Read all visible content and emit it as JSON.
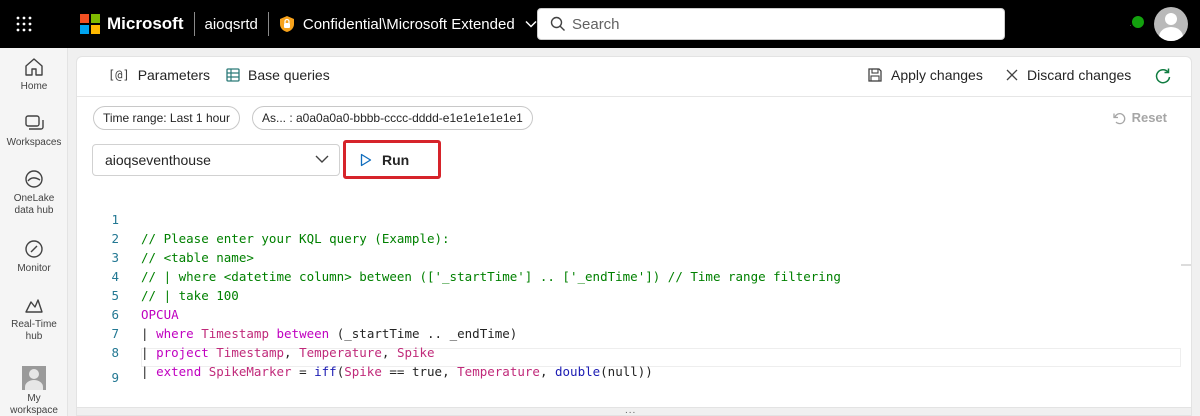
{
  "topbar": {
    "brand": "Microsoft",
    "workspace": "aioqsrtd",
    "sensitivity": "Confidential\\Microsoft Extended",
    "search_placeholder": "Search",
    "more": "..."
  },
  "nav": {
    "home": "Home",
    "workspaces": "Workspaces",
    "onelake_line1": "OneLake",
    "onelake_line2": "data hub",
    "monitor": "Monitor",
    "rth_line1": "Real-Time",
    "rth_line2": "hub",
    "my_ws_line1": "My",
    "my_ws_line2": "workspace"
  },
  "toolbar": {
    "parameters": "Parameters",
    "parameters_icon": "[@]",
    "base_queries": "Base queries",
    "apply": "Apply changes",
    "discard": "Discard changes"
  },
  "filters": {
    "time_range": "Time range: Last 1 hour",
    "as_of": "As... : a0a0a0a0-bbbb-cccc-dddd-e1e1e1e1e1e1",
    "reset": "Reset"
  },
  "query": {
    "database": "aioqseventhouse",
    "run": "Run"
  },
  "editor": {
    "line_numbers": [
      "1",
      "2",
      "3",
      "4",
      "5",
      "6",
      "7",
      "8",
      "9"
    ],
    "l1": "// Please enter your KQL query (Example):",
    "l2": "// <table name>",
    "l3": "// | where <datetime column> between (['_startTime'] .. ['_endTime']) // Time range filtering",
    "l4": "// | take 100",
    "l5": "OPCUA",
    "l6": {
      "pipe": "| ",
      "kw": "where",
      "col": "Timestamp",
      "kw2": "between",
      "rest": "(_startTime .. _endTime)"
    },
    "l7": {
      "pipe": "| ",
      "kw": "project",
      "c1": "Timestamp",
      "c2": "Temperature",
      "c3": "Spike"
    },
    "l8": {
      "pipe": "| ",
      "kw": "extend",
      "c1": "SpikeMarker",
      "eq": " = ",
      "fn": "iff",
      "c2": "Spike",
      "op": " == true, ",
      "c3": "Temperature",
      "fn2": "double",
      "nul": "(null))"
    },
    "grip": "..."
  },
  "colors": {
    "run_highlight": "#d6232a",
    "comment": "#008000",
    "keyword": "#c000c0",
    "presence": "#13a10e"
  }
}
